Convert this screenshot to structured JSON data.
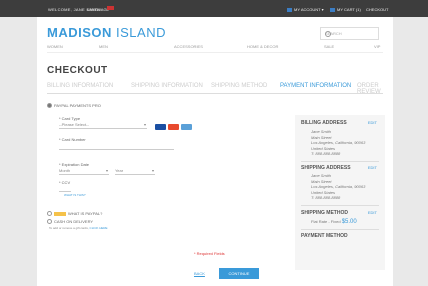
{
  "topbar": {
    "welcome": "WELCOME, JANE SMITH",
    "language": "LANGUAGE",
    "my_account": "MY ACCOUNT",
    "my_cart": "MY CART (1)",
    "checkout": "CHECKOUT",
    "colors": {
      "bg": "#3d3d3d",
      "accent": "#3b7dc4"
    }
  },
  "header": {
    "logo_main": "MADISON",
    "logo_sub": "ISLAND",
    "search_placeholder": "SEARCH",
    "nav": [
      "WOMEN",
      "MEN",
      "ACCESSORIES",
      "HOME & DECOR",
      "SALE",
      "VIP"
    ]
  },
  "checkout": {
    "title": "CHECKOUT",
    "steps": [
      {
        "label": "BILLING INFORMATION",
        "active": false
      },
      {
        "label": "SHIPPING INFORMATION",
        "active": false
      },
      {
        "label": "SHIPPING METHOD",
        "active": false
      },
      {
        "label": "PAYMENT INFORMATION",
        "active": true
      },
      {
        "label": "ORDER REVIEW",
        "active": false
      }
    ],
    "payment": {
      "option_paypal_pro": "PAYPAL PAYMENTS PRO",
      "card_type_label": "* Card Type",
      "card_type_value": "--Please Select--",
      "card_number_label": "* Card Number",
      "expiration_label": "* Expiration Date",
      "month_value": "Month",
      "year_value": "Year",
      "cvv_label": "* CCV",
      "cvv_help": "WHAT IS THIS?",
      "paypal_label": "WHAT IS PAYPAL?",
      "cod_label": "CASH ON DELIVERY",
      "gift_card_text": "To add or remove a gift cards,",
      "gift_card_link": "CLICK HERE",
      "required_note": "* Required Fields",
      "back_label": "BACK",
      "continue_label": "CONTINUE"
    },
    "sidebar": {
      "billing_title": "BILLING ADDRESS",
      "billing_edit": "EDIT",
      "billing_lines": [
        "Jane Smith",
        "Main Street",
        "Los Angeles, California, 90063",
        "United States",
        "T: 888-888-8888"
      ],
      "shipping_title": "SHIPPING ADDRESS",
      "shipping_edit": "EDIT",
      "shipping_lines": [
        "Jane Smith",
        "Main Street",
        "Los Angeles, California, 90063",
        "United States",
        "T: 888-888-8888"
      ],
      "method_title": "SHIPPING METHOD",
      "method_edit": "EDIT",
      "method_text": "Flat Rate - Fixed",
      "method_price": "$5.00",
      "payment_title": "PAYMENT METHOD"
    }
  }
}
